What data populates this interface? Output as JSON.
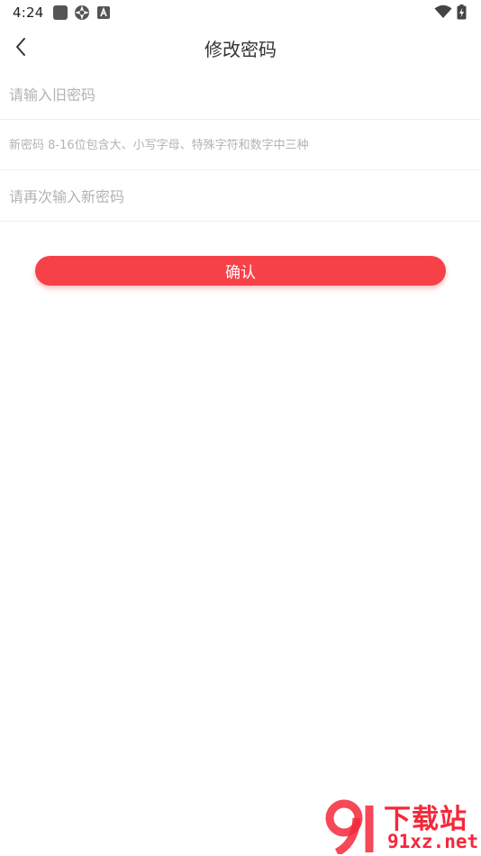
{
  "status_bar": {
    "time": "4:24",
    "icons": [
      "app-square-icon",
      "aperture-icon",
      "app-a-icon",
      "wifi-icon",
      "battery-charging-icon"
    ]
  },
  "header": {
    "title": "修改密码",
    "back_icon": "chevron-left-icon"
  },
  "form": {
    "old_password": {
      "value": "",
      "placeholder": "请输入旧密码"
    },
    "new_password": {
      "value": "",
      "placeholder": "新密码 8-16位包含大、小写字母、特殊字符和数字中三种"
    },
    "confirm_password": {
      "value": "",
      "placeholder": "请再次输入新密码"
    }
  },
  "confirm_button": {
    "label": "确认"
  },
  "colors": {
    "accent": "#f74148",
    "text": "#333333",
    "placeholder": "#b3b3b3",
    "divider": "#eeeeee",
    "watermark": "#f5283a"
  },
  "watermark": {
    "logo_text": "91",
    "site_name": "下载站",
    "url": "91xz.net"
  }
}
